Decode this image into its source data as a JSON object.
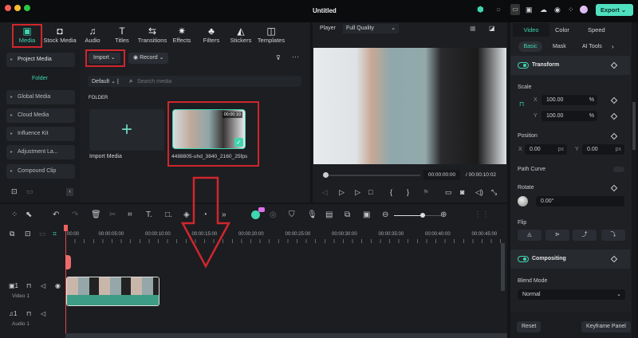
{
  "title": "Untitled",
  "export_label": "Export",
  "toolbar": [
    "Media",
    "Stock Media",
    "Audio",
    "Titles",
    "Transitions",
    "Effects",
    "Filters",
    "Stickers",
    "Templates"
  ],
  "sidebar": {
    "items": [
      "Project Media",
      "Folder",
      "Global Media",
      "Cloud Media",
      "Influence Kit",
      "Adjustment La...",
      "Compound Clip"
    ]
  },
  "media": {
    "import": "Import",
    "record": "Record",
    "sort": "Default",
    "search_placeholder": "Search media",
    "folder_heading": "FOLDER",
    "import_media": "Import Media",
    "clip_name": "4488805-uhd_3840_2160_25fps",
    "clip_duration": "00:00:10"
  },
  "player": {
    "label": "Player",
    "quality": "Full Quality",
    "current_time": "00:00:00:00",
    "total_time": "/ 00:00:10:02"
  },
  "right": {
    "tabs": [
      "Video",
      "Color",
      "Speed"
    ],
    "subtabs": [
      "Basic",
      "Mask",
      "AI Tools"
    ],
    "transform": "Transform",
    "scale": "Scale",
    "scale_x": "100.00",
    "scale_y": "100.00",
    "pct": "%",
    "position": "Position",
    "pos_x": "0.00",
    "pos_y": "0.00",
    "px": "px",
    "x": "X",
    "y": "Y",
    "path_curve": "Path Curve",
    "rotate": "Rotate",
    "rotate_val": "0.00°",
    "flip": "Flip",
    "compositing": "Compositing",
    "blend_mode": "Blend Mode",
    "blend_val": "Normal",
    "reset": "Reset",
    "keyframe": "Keyframe Panel"
  },
  "timeline": {
    "ticks": [
      "00:00",
      "00:00:05:00",
      "00:00:10:00",
      "00:00:15:00",
      "00:00:20:00",
      "00:00:25:00",
      "00:00:30:00",
      "00:00:35:00",
      "00:00:40:00",
      "00:00:45:00"
    ],
    "video_track": "Video 1",
    "audio_track": "Audio 1",
    "zoom_level": 0.6
  },
  "accent": "#3fd6b0"
}
